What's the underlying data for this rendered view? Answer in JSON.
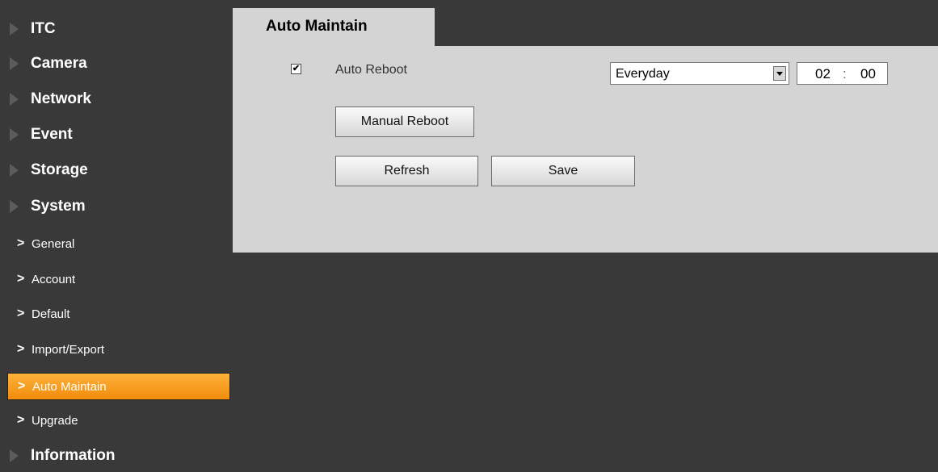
{
  "sidebar": {
    "top_items": [
      {
        "label": "ITC"
      },
      {
        "label": "Camera"
      },
      {
        "label": "Network"
      },
      {
        "label": "Event"
      },
      {
        "label": "Storage"
      },
      {
        "label": "System"
      },
      {
        "label": "Information"
      }
    ],
    "system_sub_items": [
      {
        "label": "General"
      },
      {
        "label": "Account"
      },
      {
        "label": "Default"
      },
      {
        "label": "Import/Export"
      },
      {
        "label": "Auto Maintain",
        "active": true
      },
      {
        "label": "Upgrade"
      }
    ],
    "chevron": ">"
  },
  "main": {
    "tab_title": "Auto Maintain",
    "auto_reboot": {
      "checked": true,
      "check_mark": "✔",
      "label": "Auto Reboot",
      "schedule": "Everyday",
      "hour": "02",
      "separator": ":",
      "minute": "00"
    },
    "buttons": {
      "manual_reboot": "Manual Reboot",
      "refresh": "Refresh",
      "save": "Save"
    }
  },
  "colors": {
    "background": "#393939",
    "panel": "#d4d4d4",
    "active_item": "#f7a02a",
    "collapsed_arrow": "#5c5c5c"
  },
  "icons": {
    "collapsed_arrow": "triangle-right-icon",
    "sub_item_marker": "chevron-right-icon",
    "select_dropdown": "dropdown-arrow-icon"
  }
}
